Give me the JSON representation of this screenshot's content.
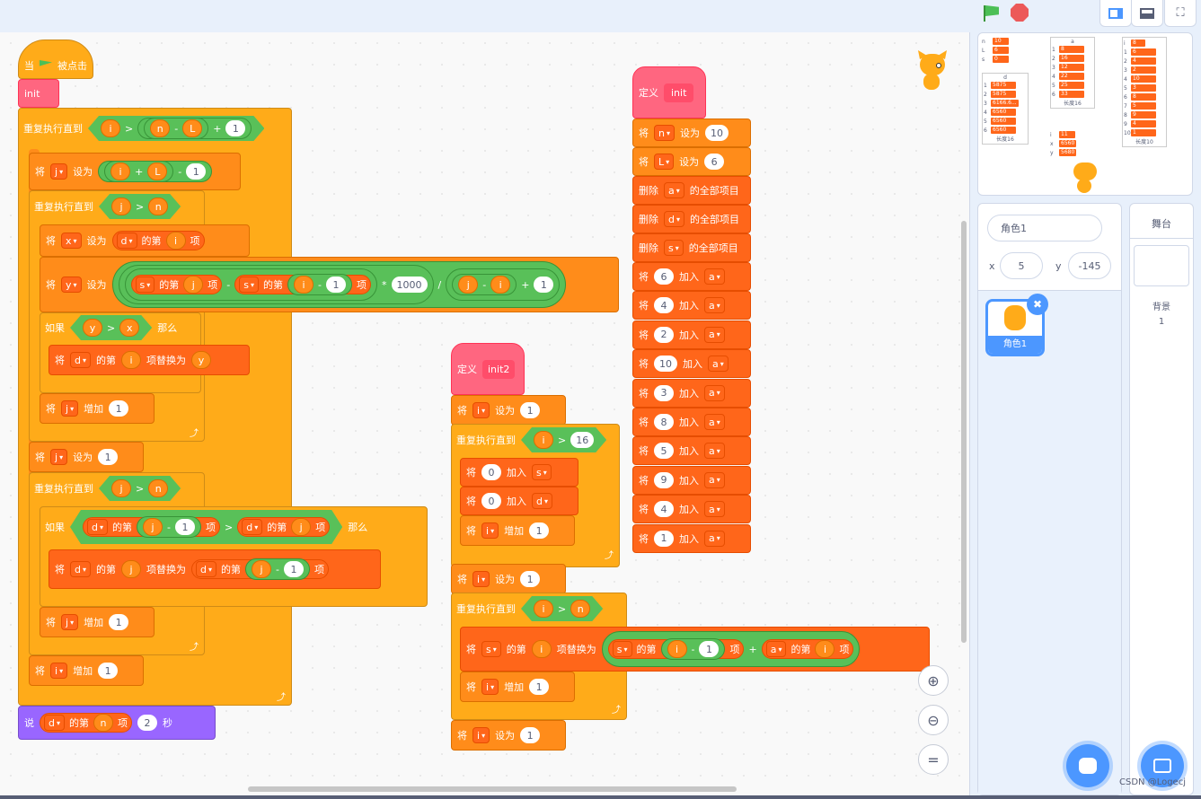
{
  "topbar": {
    "layout_small": "small-stage-icon",
    "layout_large": "large-stage-icon",
    "fullscreen": "fullscreen-icon"
  },
  "hat": {
    "when": "当",
    "clicked": "被点击"
  },
  "main": {
    "init": "init",
    "r1": {
      "label": "重复执行直到",
      "i": "i",
      "gt": ">",
      "n": "n",
      "minus": "-",
      "L": "L",
      "plus": "+",
      "one": "1"
    },
    "setj": {
      "set": "将",
      "var": "j",
      "to": "设为",
      "i": "i",
      "plus": "+",
      "L": "L",
      "minus": "-",
      "one": "1"
    },
    "r2": {
      "label": "重复执行直到",
      "j": "j",
      "gt": ">",
      "n": "n"
    },
    "setx": {
      "set": "将",
      "var": "x",
      "to": "设为",
      "list": "d",
      "the": "的第",
      "i": "i",
      "item": "项"
    },
    "sety": {
      "set": "将",
      "var": "y",
      "to": "设为",
      "s": "s",
      "the": "的第",
      "j": "j",
      "item": "项",
      "minus": "-",
      "i": "i",
      "one": "1",
      "times": "*",
      "k": "1000",
      "div": "/",
      "plus": "+"
    },
    "if1": {
      "if": "如果",
      "y": "y",
      "gt": ">",
      "x": "x",
      "then": "那么"
    },
    "rep1": {
      "set": "将",
      "list": "d",
      "the": "的第",
      "i": "i",
      "replace": "项替换为",
      "y": "y"
    },
    "incj": {
      "set": "将",
      "var": "j",
      "inc": "增加",
      "one": "1"
    },
    "setj1": {
      "set": "将",
      "var": "j",
      "to": "设为",
      "one": "1"
    },
    "r3": {
      "label": "重复执行直到",
      "j": "j",
      "gt": ">",
      "n": "n"
    },
    "if2": {
      "if": "如果",
      "d": "d",
      "the": "的第",
      "j": "j",
      "minus": "-",
      "one": "1",
      "item": "项",
      "gt": ">",
      "then": "那么"
    },
    "rep2": {
      "set": "将",
      "d": "d",
      "the": "的第",
      "j": "j",
      "replace": "项替换为",
      "minus": "-",
      "one": "1",
      "item": "项"
    },
    "incj2": {
      "set": "将",
      "var": "j",
      "inc": "增加",
      "one": "1"
    },
    "inci": {
      "set": "将",
      "var": "i",
      "inc": "增加",
      "one": "1"
    },
    "say": {
      "say": "说",
      "d": "d",
      "the": "的第",
      "n": "n",
      "item": "项",
      "two": "2",
      "secs": "秒"
    }
  },
  "init2": {
    "define": "定义",
    "name": "init2",
    "seti": {
      "set": "将",
      "var": "i",
      "to": "设为",
      "one": "1"
    },
    "r": {
      "label": "重复执行直到",
      "i": "i",
      "gt": ">",
      "v": "16"
    },
    "adds": {
      "set": "将",
      "zero": "0",
      "add": "加入",
      "list": "s"
    },
    "addd": {
      "set": "将",
      "zero": "0",
      "add": "加入",
      "list": "d"
    },
    "inc": {
      "set": "将",
      "var": "i",
      "inc": "增加",
      "one": "1"
    },
    "seti2": {
      "set": "将",
      "var": "i",
      "to": "设为",
      "one": "1"
    },
    "r2": {
      "label": "重复执行直到",
      "i": "i",
      "gt": ">",
      "n": "n"
    },
    "rep": {
      "set": "将",
      "s": "s",
      "the": "的第",
      "i": "i",
      "replace": "项替换为",
      "minus": "-",
      "one": "1",
      "item": "项",
      "plus": "+",
      "a": "a"
    },
    "inc2": {
      "set": "将",
      "var": "i",
      "inc": "增加",
      "one": "1"
    },
    "seti3": {
      "set": "将",
      "var": "i",
      "to": "设为",
      "one": "1"
    }
  },
  "initdef": {
    "define": "定义",
    "name": "init",
    "setn": {
      "set": "将",
      "var": "n",
      "to": "设为",
      "val": "10"
    },
    "setL": {
      "set": "将",
      "var": "L",
      "to": "设为",
      "val": "6"
    },
    "del": "删除",
    "delall": "的全部项目",
    "lists": [
      "a",
      "d",
      "s"
    ],
    "set": "将",
    "add": "加入",
    "target": "a",
    "adds": [
      "6",
      "4",
      "2",
      "10",
      "3",
      "8",
      "5",
      "9",
      "4",
      "1"
    ]
  },
  "monitors": {
    "vars": [
      {
        "name": "n",
        "val": "10"
      },
      {
        "name": "L",
        "val": "6"
      },
      {
        "name": "s",
        "val": "0"
      }
    ],
    "d": {
      "title": "d",
      "items": [
        "5875",
        "5875",
        "6166.6...",
        "6560",
        "6560",
        "6560"
      ],
      "len": "长度16"
    },
    "a_list": {
      "title": "a",
      "items": [
        "8",
        "16",
        "12",
        "22",
        "25",
        "33"
      ],
      "len": "长度16"
    },
    "i": {
      "name": "i",
      "val": "11"
    },
    "x": {
      "name": "x",
      "val": "6560"
    },
    "y": {
      "name": "y",
      "val": "5680"
    },
    "i2": {
      "name": "i",
      "val": "8"
    },
    "a": {
      "items": [
        "6",
        "4",
        "2",
        "10",
        "3",
        "8",
        "5",
        "9",
        "4",
        "1"
      ],
      "len": "长度10"
    }
  },
  "sprite": {
    "name": "角色1",
    "x_label": "x",
    "x": "5",
    "y_label": "y",
    "y": "-145",
    "thumb": "角色1"
  },
  "stagepanel": {
    "title": "舞台",
    "backdrops": "背景",
    "count": "1"
  },
  "watermark": "CSDN @Logecj"
}
